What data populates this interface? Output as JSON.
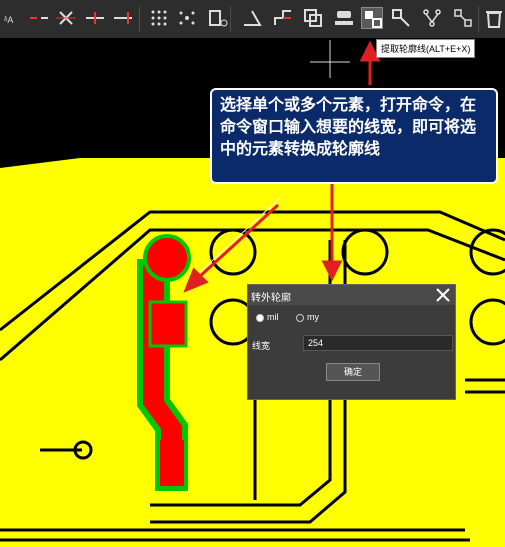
{
  "toolbar": {
    "icons": [
      "sort-az-icon",
      "red-break-line-icon",
      "x-cross-line-icon",
      "red-tick-line-icon",
      "red-tick-line-2-icon",
      "dot-grid-icon",
      "sparkle-nodes-icon",
      "rect-marker-icon",
      "angle-icon",
      "step-line-icon",
      "copy-frames-icon",
      "flip-stamp-icon",
      "extract-outline-icon",
      "outline-pattern-icon",
      "tree-nodes-icon",
      "node-link-icon",
      "trash-icon"
    ],
    "active_index": 12
  },
  "tooltip": {
    "text": "提取轮廓线(ALT+E+X)"
  },
  "callout": {
    "text": "选择单个或多个元素，打开命令，在命令窗口输入想要的线宽，即可将选中的元素转换成轮廓线"
  },
  "dialog": {
    "title": "转外轮廓",
    "unit_mil": "mil",
    "unit_my": "my",
    "selected_unit": "mil",
    "width_label": "线宽",
    "width_value": "254",
    "ok_label": "确定"
  },
  "colors": {
    "board": "#ffff00",
    "trace": "#000000",
    "highlight": "#ff0000",
    "outline": "#00c800",
    "arrow": "#e02020",
    "callout_bg": "#0a2a6a"
  }
}
